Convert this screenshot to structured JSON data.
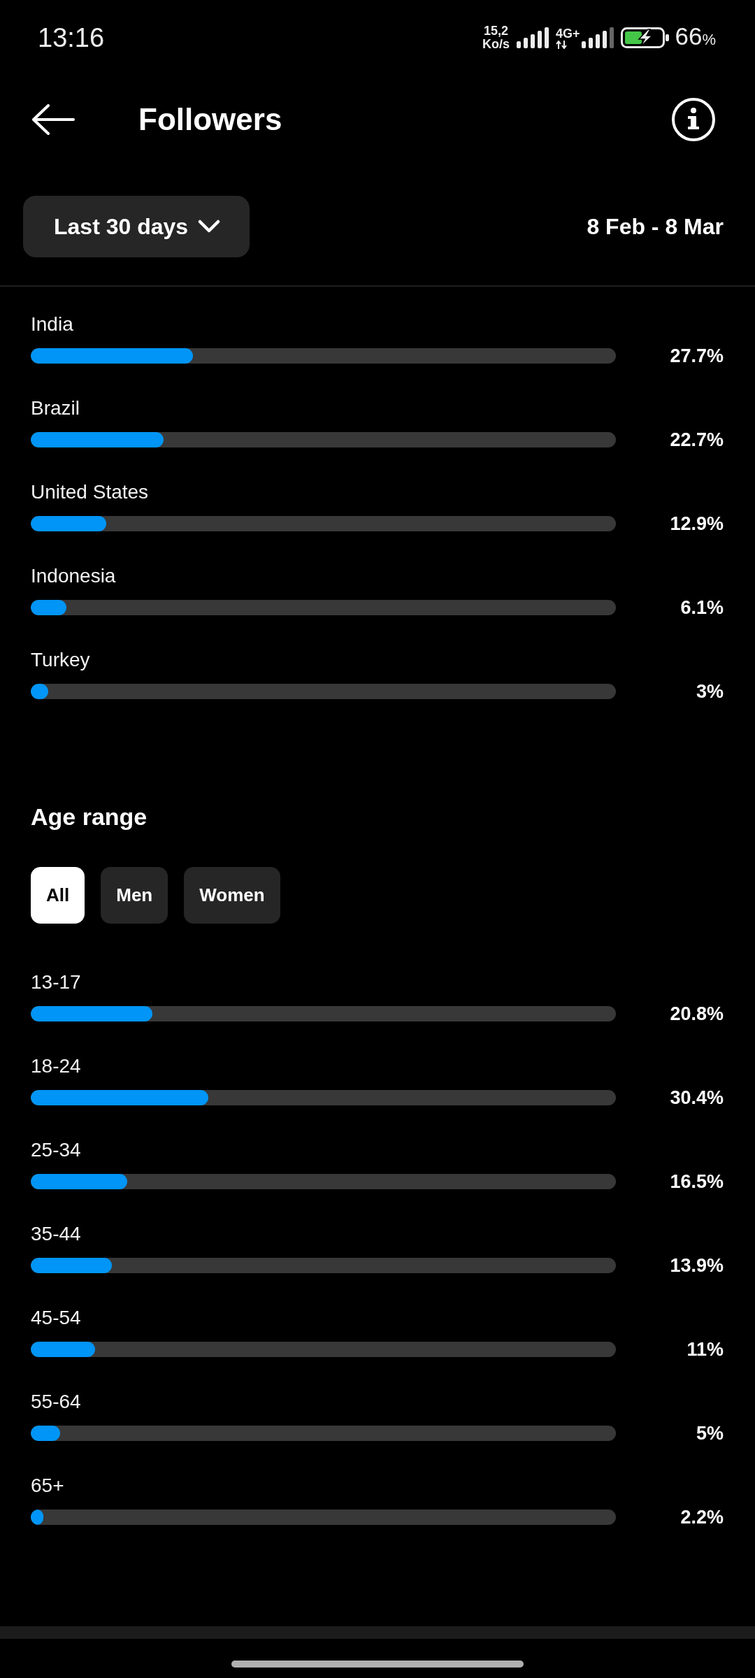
{
  "status_bar": {
    "time": "13:16",
    "network_speed": {
      "value": "15,2",
      "unit": "Ko/s"
    },
    "network_type": "4G+",
    "battery": {
      "percent": "66",
      "unit": "%",
      "charging": true
    }
  },
  "header": {
    "title": "Followers"
  },
  "filter": {
    "period": "Last 30 days",
    "date_range": "8 Feb - 8 Mar"
  },
  "countries": [
    {
      "name": "India",
      "value": "27.7%",
      "level": 0.277
    },
    {
      "name": "Brazil",
      "value": "22.7%",
      "level": 0.227
    },
    {
      "name": "United States",
      "value": "12.9%",
      "level": 0.129
    },
    {
      "name": "Indonesia",
      "value": "6.1%",
      "level": 0.061
    },
    {
      "name": "Turkey",
      "value": "3%",
      "level": 0.03
    }
  ],
  "age_range": {
    "title": "Age range",
    "tabs": [
      {
        "label": "All",
        "selected": true
      },
      {
        "label": "Men",
        "selected": false
      },
      {
        "label": "Women",
        "selected": false
      }
    ],
    "rows": [
      {
        "label": "13-17",
        "value": "20.8%",
        "level": 0.208
      },
      {
        "label": "18-24",
        "value": "30.4%",
        "level": 0.304
      },
      {
        "label": "25-34",
        "value": "16.5%",
        "level": 0.165
      },
      {
        "label": "35-44",
        "value": "13.9%",
        "level": 0.139
      },
      {
        "label": "45-54",
        "value": "11%",
        "level": 0.11
      },
      {
        "label": "55-64",
        "value": "5%",
        "level": 0.05
      },
      {
        "label": "65+",
        "value": "2.2%",
        "level": 0.022
      }
    ]
  }
}
